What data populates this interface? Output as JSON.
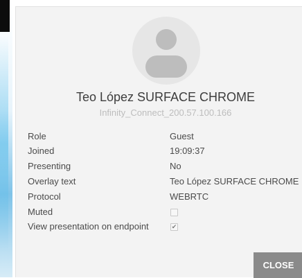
{
  "participant": {
    "name": "Teo López SURFACE CHROME",
    "subname": "Infinity_Connect_200.57.100.166",
    "avatar_icon": "default-user-avatar-icon"
  },
  "details": [
    {
      "label": "Role",
      "value": "Guest"
    },
    {
      "label": "Joined",
      "value": "19:09:37"
    },
    {
      "label": "Presenting",
      "value": "No"
    },
    {
      "label": "Overlay text",
      "value": "Teo López SURFACE CHROME"
    },
    {
      "label": "Protocol",
      "value": "WEBRTC"
    },
    {
      "label": "Muted",
      "checked": false
    },
    {
      "label": "View presentation on endpoint",
      "checked": true
    }
  ],
  "actions": {
    "close_label": "CLOSE"
  },
  "colors": {
    "dialog_bg": "#f3f3f3",
    "close_button_bg": "#8a8a8a"
  }
}
